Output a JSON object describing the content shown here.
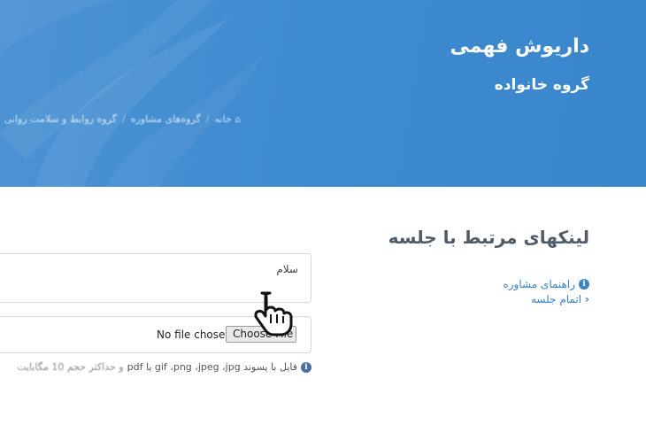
{
  "header": {
    "name": "داریوش فهمی",
    "subtitle": "گروه خانواده",
    "breadcrumb": [
      "خانه",
      "گروه‌های مشاوره",
      "گروه روابط و سلامت روانی"
    ]
  },
  "section": {
    "title": "لینکهای مرتبط با جلسه",
    "links": [
      {
        "label": "راهنمای مشاوره",
        "icon": "info-icon"
      },
      {
        "label": "اتمام جلسه",
        "icon": "chevron-left-icon"
      }
    ]
  },
  "form": {
    "message_value": "سلام",
    "file_button_label": "Choose File",
    "file_status": "No file chosen",
    "hint_text": "فایل با پسوند gif ،png ،jpeg ،jpg یا pdf",
    "hint_text_faded": "و حداکثر حجم 10 مگابایت"
  },
  "colors": {
    "header_blue": "#3f8bd0",
    "link_blue": "#3a82c9",
    "title_gray": "#4f5b66"
  }
}
